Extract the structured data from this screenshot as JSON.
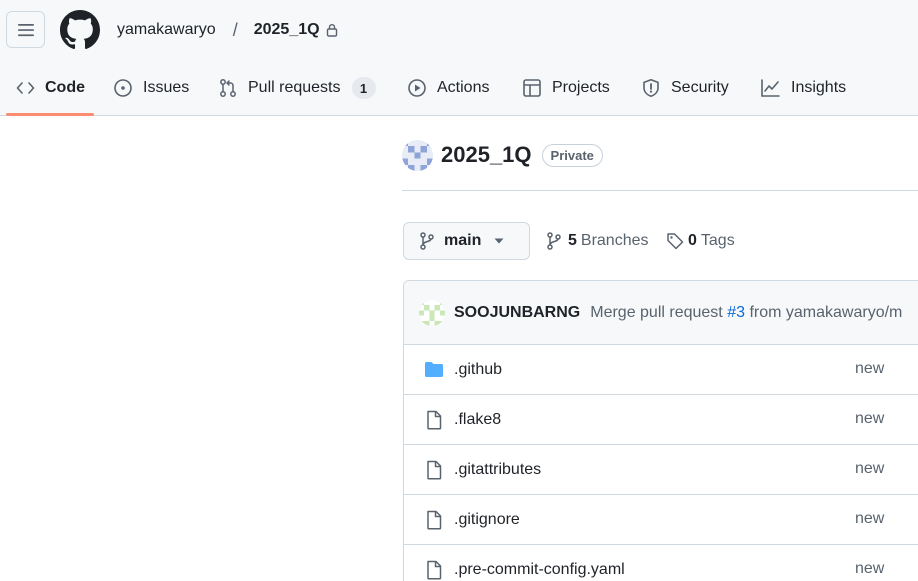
{
  "header": {
    "owner": "yamakawaryo",
    "separator": "/",
    "repo": "2025_1Q"
  },
  "tabs": [
    {
      "label": "Code",
      "icon": "code-icon"
    },
    {
      "label": "Issues",
      "icon": "issue-opened-icon"
    },
    {
      "label": "Pull requests",
      "icon": "git-pull-request-icon",
      "count": "1"
    },
    {
      "label": "Actions",
      "icon": "play-icon"
    },
    {
      "label": "Projects",
      "icon": "table-icon"
    },
    {
      "label": "Security",
      "icon": "shield-icon"
    },
    {
      "label": "Insights",
      "icon": "graph-icon"
    }
  ],
  "repo": {
    "name": "2025_1Q",
    "visibility": "Private"
  },
  "branch": {
    "current": "main",
    "branches_count": "5",
    "branches_label": "Branches",
    "tags_count": "0",
    "tags_label": "Tags"
  },
  "commit": {
    "author": "SOOJUNBARNG",
    "message_prefix": "Merge pull request",
    "pr_link": "#3",
    "message_suffix": "from yamakawaryo/m"
  },
  "files": [
    {
      "name": ".github",
      "type": "folder",
      "message": "new"
    },
    {
      "name": ".flake8",
      "type": "file",
      "message": "new"
    },
    {
      "name": ".gitattributes",
      "type": "file",
      "message": "new"
    },
    {
      "name": ".gitignore",
      "type": "file",
      "message": "new"
    },
    {
      "name": ".pre-commit-config.yaml",
      "type": "file",
      "message": "new"
    }
  ],
  "colors": {
    "accent_underline": "#fd8c73",
    "link": "#0969da",
    "folder": "#54aeff",
    "muted": "#59636e"
  }
}
